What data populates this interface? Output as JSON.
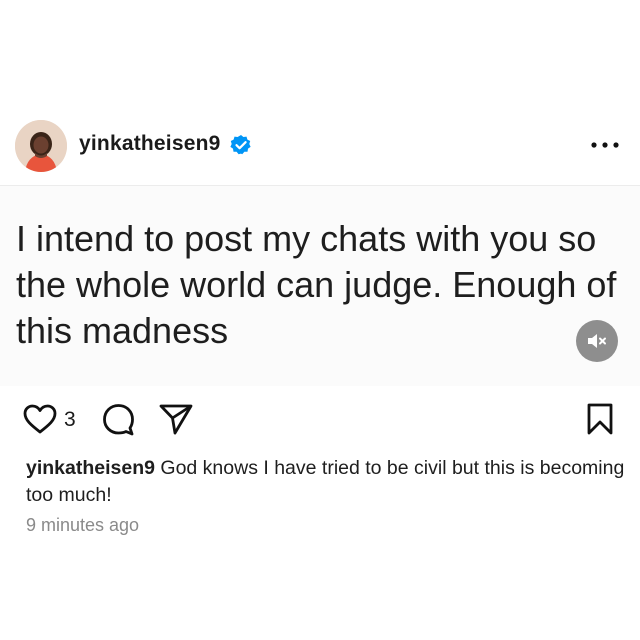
{
  "post": {
    "username": "yinkatheisen9",
    "verified": true,
    "text": "I intend to post my chats with you so\nthe whole world can judge. Enough of\nthis madness",
    "like_count": "3",
    "caption_username": "yinkatheisen9",
    "caption_text": " God knows I have tried to be civil  but this is becoming too much!",
    "timestamp": "9 minutes ago"
  },
  "icons": {
    "verified": "verified-badge-icon",
    "more": "more-options-icon",
    "mute": "muted-speaker-icon",
    "like": "heart-icon",
    "comment": "comment-bubble-icon",
    "share": "paper-plane-icon",
    "save": "bookmark-icon"
  },
  "colors": {
    "verified_blue": "#0095f6",
    "mute_bg": "#8e8e8e",
    "text": "#1e1e1e",
    "muted_text": "#8a8a8a"
  }
}
